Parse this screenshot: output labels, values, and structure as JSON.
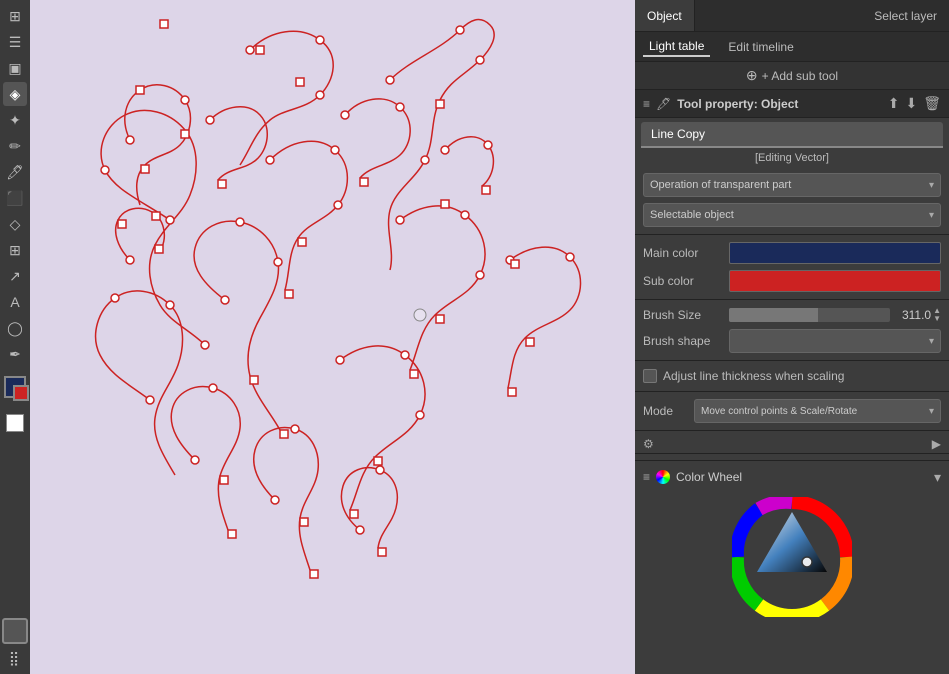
{
  "toolbar_left": {
    "icons": [
      "⊞",
      "☰",
      "📷",
      "🎨",
      "⊕",
      "◉",
      "✦",
      "✏️",
      "🖊",
      "⬛",
      "◇",
      "⊡",
      "↗",
      "A",
      "◯",
      "✒"
    ]
  },
  "right_panel": {
    "tabs": {
      "object_label": "Object",
      "select_layer_label": "Select layer",
      "light_table_label": "Light table",
      "edit_timeline_label": "Edit timeline",
      "add_sub_tool_label": "+ Add sub tool"
    },
    "tool_property": {
      "header_label": "Tool property: Object",
      "line_copy_tab": "Line Copy",
      "editing_vector_label": "[Editing Vector]",
      "operation_label": "Operation of transparent part",
      "selectable_object_label": "Selectable object",
      "main_color_label": "Main color",
      "sub_color_label": "Sub color",
      "brush_size_label": "Brush Size",
      "brush_size_value": "311.0",
      "brush_shape_label": "Brush shape",
      "adjust_line_label": "Adjust line thickness when scaling",
      "mode_label": "Mode",
      "mode_value": "Move control points & Scale/Rotate"
    },
    "color_wheel": {
      "label": "Color Wheel"
    }
  },
  "icons": {
    "export": "⬆",
    "import": "⬇",
    "trash": "🗑",
    "settings": "⚙",
    "expand": "▶",
    "dropdown_arrow": "▾",
    "spinner_up": "▲",
    "spinner_down": "▼",
    "tool_icon": "🖊",
    "menu_icon": "≡",
    "plus_icon": "⊕"
  }
}
